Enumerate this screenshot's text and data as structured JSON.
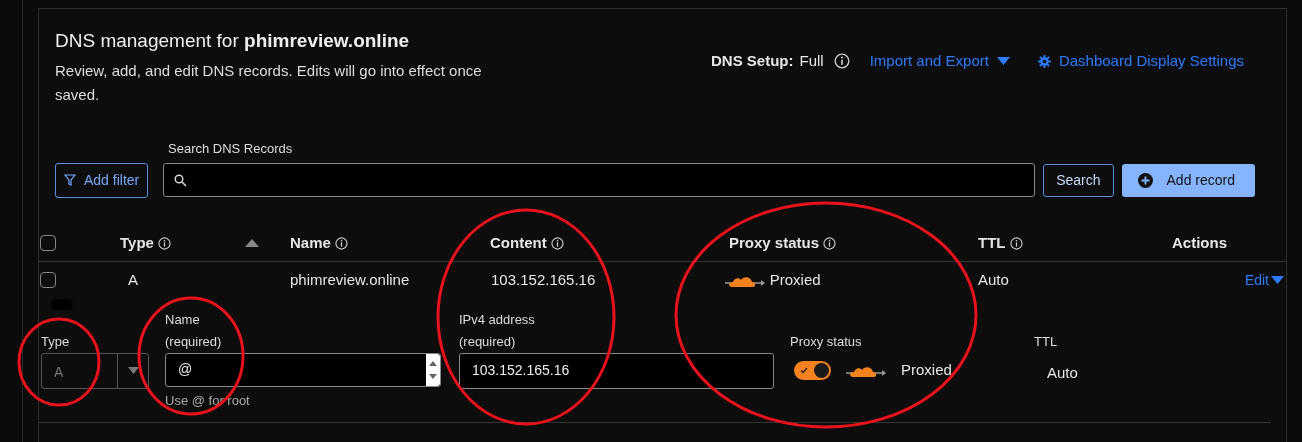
{
  "header": {
    "title": "DNS management for **phimreview.online**",
    "description": "Review, add, and edit DNS records. Edits will go into effect once saved.",
    "dns_setup_label": "DNS Setup:",
    "dns_setup_value": "Full",
    "import_export": "Import and Export",
    "display_settings": "Dashboard Display Settings"
  },
  "toolbar": {
    "add_filter": "Add filter",
    "search_label": "Search DNS Records",
    "search_button": "Search",
    "add_record": "Add record"
  },
  "table": {
    "select_all_checked": false,
    "columns": [
      {
        "label": "Type",
        "info": true,
        "sorted": true
      },
      {
        "label": "Name",
        "info": true,
        "sorted": false
      },
      {
        "label": "Content",
        "info": true,
        "sorted": false
      },
      {
        "label": "Proxy status",
        "info": true,
        "sorted": false
      },
      {
        "label": "TTL",
        "info": true,
        "sorted": false
      },
      {
        "label": "Actions",
        "info": false,
        "sorted": false
      }
    ],
    "rows": [
      {
        "checked": false,
        "type": "A",
        "name": "phimreview.online",
        "content": "103.152.165.16",
        "proxied": true,
        "proxy_status": "Proxied",
        "ttl": "Auto",
        "action": "Edit",
        "expanded": true
      }
    ]
  },
  "edit_form": {
    "type_label": "Type",
    "type_value": "A",
    "type_disabled": true,
    "name_label": "Name",
    "name_required": "(required)",
    "name_value": "@",
    "name_hint": "Use @ for root",
    "content_label": "IPv4 address",
    "content_required": "(required)",
    "content_value": "103.152.165.16",
    "proxy_label": "Proxy status",
    "proxy_on": true,
    "proxy_text": "Proxied",
    "ttl_label": "TTL",
    "ttl_value": "Auto"
  }
}
